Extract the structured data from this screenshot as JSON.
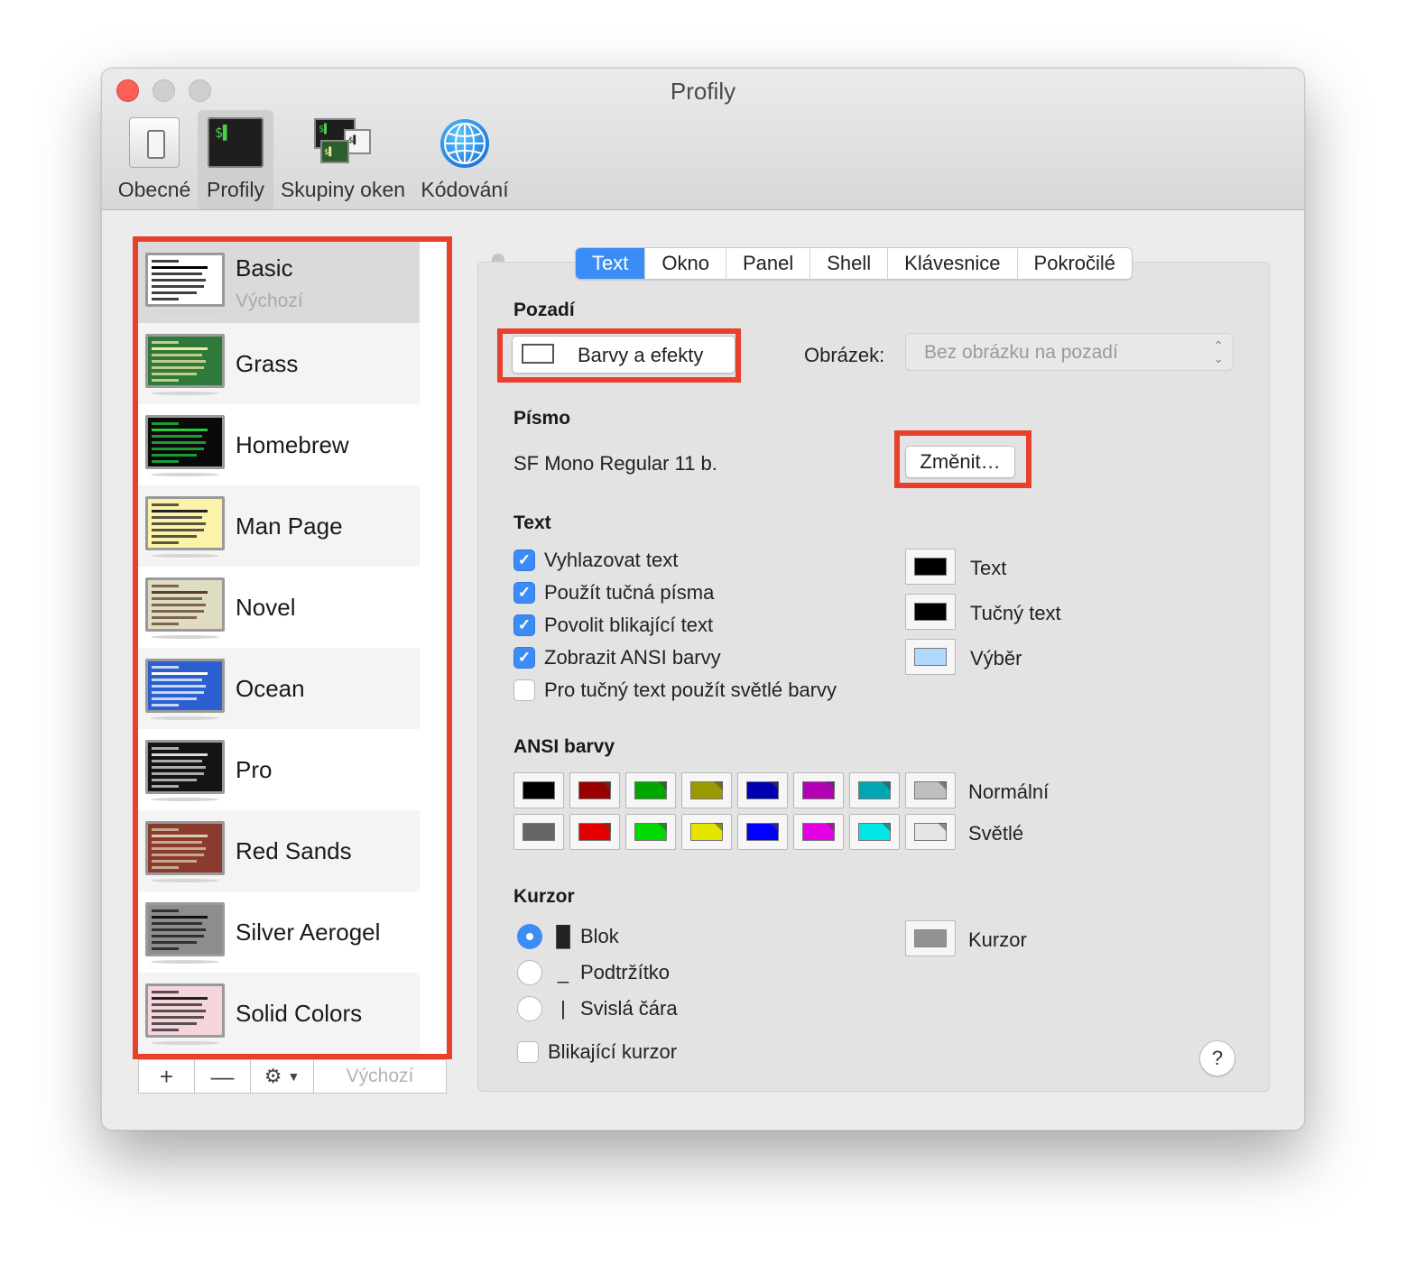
{
  "window": {
    "title": "Profily"
  },
  "toolbar": {
    "items": [
      {
        "label": "Obecné",
        "icon": "general-icon"
      },
      {
        "label": "Profily",
        "icon": "terminal-icon",
        "selected": true
      },
      {
        "label": "Skupiny oken",
        "icon": "window-groups-icon"
      },
      {
        "label": "Kódování",
        "icon": "globe-icon"
      }
    ]
  },
  "profiles": {
    "items": [
      {
        "name": "Basic",
        "sub": "Výchozí",
        "bg": "#ffffff",
        "fg": "#000000"
      },
      {
        "name": "Grass",
        "bg": "#2f7a3a",
        "fg": "#f2e9a7"
      },
      {
        "name": "Homebrew",
        "bg": "#0a0a0a",
        "fg": "#27c93f"
      },
      {
        "name": "Man Page",
        "bg": "#fbf3a8",
        "fg": "#222222"
      },
      {
        "name": "Novel",
        "bg": "#e0dcc2",
        "fg": "#5a3d2b"
      },
      {
        "name": "Ocean",
        "bg": "#2c5fd0",
        "fg": "#ffffff"
      },
      {
        "name": "Pro",
        "bg": "#141414",
        "fg": "#dddddd"
      },
      {
        "name": "Red Sands",
        "bg": "#8a3b2d",
        "fg": "#dccfb0"
      },
      {
        "name": "Silver Aerogel",
        "bg": "#8d8d8d",
        "fg": "#111111"
      },
      {
        "name": "Solid Colors",
        "bg": "#f5d4dc",
        "fg": "#222222"
      }
    ],
    "buttons": {
      "add": "+",
      "remove": "—",
      "gear": "⚙",
      "default": "Výchozí"
    }
  },
  "tabs": [
    {
      "label": "Text",
      "active": true
    },
    {
      "label": "Okno"
    },
    {
      "label": "Panel"
    },
    {
      "label": "Shell"
    },
    {
      "label": "Klávesnice"
    },
    {
      "label": "Pokročilé"
    }
  ],
  "background": {
    "heading": "Pozadí",
    "colors_button": "Barvy a efekty",
    "image_label": "Obrázek:",
    "image_select": "Bez obrázku na pozadí"
  },
  "font": {
    "heading": "Písmo",
    "value": "SF Mono Regular 11 b.",
    "change_button": "Změnit…"
  },
  "text": {
    "heading": "Text",
    "checkboxes": [
      {
        "label": "Vyhlazovat text",
        "checked": true
      },
      {
        "label": "Použít tučná písma",
        "checked": true
      },
      {
        "label": "Povolit blikající text",
        "checked": true
      },
      {
        "label": "Zobrazit ANSI barvy",
        "checked": true
      },
      {
        "label": "Pro tučný text použít světlé barvy",
        "checked": false
      }
    ],
    "colors": [
      {
        "label": "Text",
        "color": "#000000"
      },
      {
        "label": "Tučný text",
        "color": "#000000"
      },
      {
        "label": "Výběr",
        "color": "#b3d7ff"
      }
    ]
  },
  "ansi": {
    "heading": "ANSI barvy",
    "normal_label": "Normální",
    "bright_label": "Světlé",
    "normal": [
      "#000000",
      "#990000",
      "#00a600",
      "#999900",
      "#0000b2",
      "#b200b2",
      "#00a6b2",
      "#bfbfbf"
    ],
    "bright": [
      "#666666",
      "#e50000",
      "#00d900",
      "#e5e500",
      "#0000ff",
      "#e500e5",
      "#00e5e5",
      "#e5e5e5"
    ]
  },
  "cursor": {
    "heading": "Kurzor",
    "options": [
      {
        "glyph": "█",
        "label": "Blok",
        "selected": true
      },
      {
        "glyph": "_",
        "label": "Podtržítko",
        "selected": false
      },
      {
        "glyph": "|",
        "label": "Svislá čára",
        "selected": false
      }
    ],
    "blink_label": "Blikající kurzor",
    "color_label": "Kurzor",
    "color": "#929292"
  },
  "help": "?"
}
